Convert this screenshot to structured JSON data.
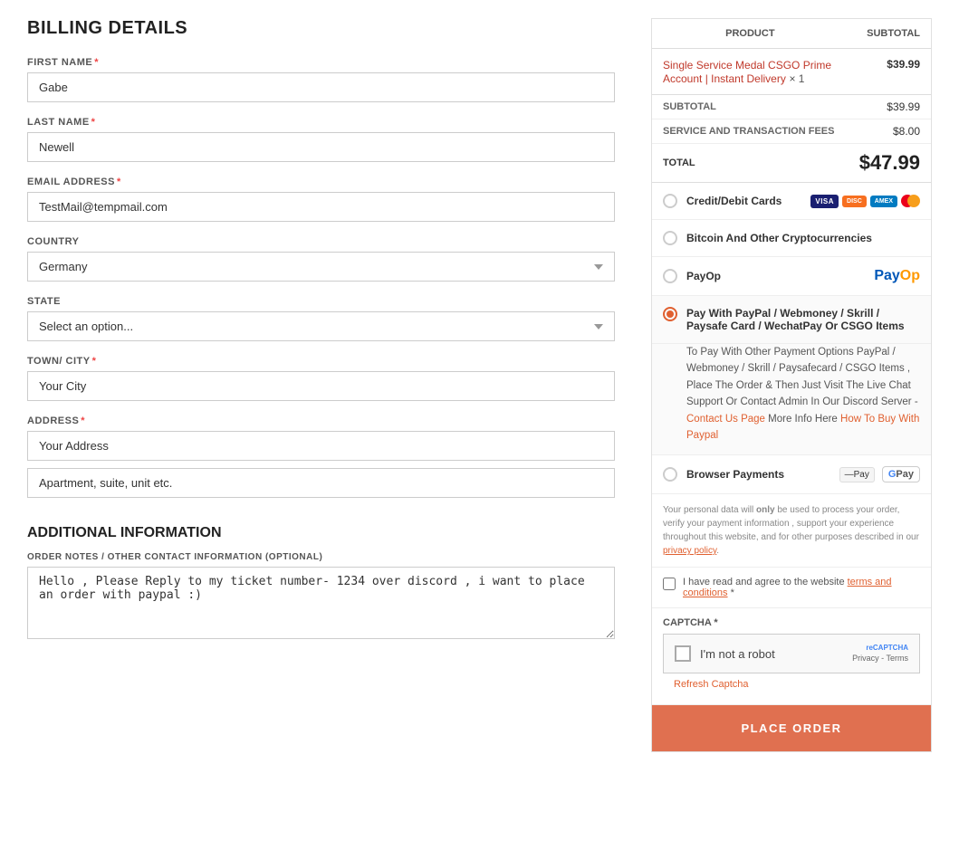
{
  "billing": {
    "title": "BILLING DETAILS",
    "fields": {
      "first_name": {
        "label": "FIRST NAME",
        "required": true,
        "value": "Gabe"
      },
      "last_name": {
        "label": "LAST NAME",
        "required": true,
        "value": "Newell"
      },
      "email": {
        "label": "EMAIL ADDRESS",
        "required": true,
        "value": "TestMail@tempmail.com"
      },
      "country": {
        "label": "COUNTRY",
        "required": false,
        "value": "Germany"
      },
      "state": {
        "label": "STATE",
        "required": false,
        "placeholder": "Select an option..."
      },
      "town": {
        "label": "TOWN/ CITY",
        "required": true,
        "value": "Your City"
      },
      "address": {
        "label": "ADDRESS",
        "required": true,
        "value": "Your Address",
        "address2_placeholder": "Apartment, suite, unit etc."
      }
    }
  },
  "additional": {
    "title": "ADDITIONAL INFORMATION",
    "notes_label": "ORDER NOTES / OTHER CONTACT INFORMATION (OPTIONAL)",
    "notes_value": "Hello , Please Reply to my ticket number- 1234 over discord , i want to place an order with paypal :)"
  },
  "order_summary": {
    "product_header": "PRODUCT",
    "subtotal_header": "SUBTOTAL",
    "product_name": "Single Service Medal CSGO Prime Account | Instant Delivery",
    "product_qty": "× 1",
    "product_price": "$39.99",
    "subtotal_label": "SUBTOTAL",
    "subtotal_value": "$39.99",
    "fees_label": "SERVICE AND TRANSACTION FEES",
    "fees_value": "$8.00",
    "total_label": "TOTAL",
    "total_value": "$47.99"
  },
  "payment": {
    "options": [
      {
        "id": "credit",
        "label": "Credit/Debit Cards",
        "checked": false,
        "has_card_icons": true
      },
      {
        "id": "crypto",
        "label": "Bitcoin And Other Cryptocurrencies",
        "checked": false,
        "has_card_icons": false
      },
      {
        "id": "payop",
        "label": "PayOp",
        "checked": false,
        "has_payop": true
      },
      {
        "id": "paypal",
        "label": "Pay With PayPal / Webmoney / Skrill / Paysafe Card / WechatPay Or CSGO Items",
        "checked": true,
        "expanded": true
      },
      {
        "id": "browser",
        "label": "Browser Payments",
        "checked": false,
        "has_browser_icons": true
      }
    ],
    "paypal_description": "To Pay With Other Payment Options PayPal / Webmoney / Skrill / Paysafecard / CSGO Items , Place The Order & Then Just Visit The Live Chat Support Or Contact Admin In Our Discord Server -",
    "contact_us_text": "Contact Us Page",
    "more_info_text": "More Info Here",
    "how_to_buy_text": "How To Buy With Paypal"
  },
  "privacy": {
    "text": "Your personal data will only be used to process your order, verify your payment information , support your experience throughout this website, and for other purposes described in our",
    "privacy_link": "privacy policy",
    "full_text": "."
  },
  "terms": {
    "label_pre": "I have read and agree to the website",
    "link": "terms and conditions",
    "required": true
  },
  "captcha": {
    "label": "CAPTCHA",
    "required": true,
    "checkbox_text": "I'm not a robot",
    "recaptcha_text": "reCAPTCHA",
    "privacy_text": "Privacy",
    "terms_text": "Terms",
    "refresh_label": "Refresh Captcha"
  },
  "place_order": {
    "label": "PLACE ORDER"
  }
}
